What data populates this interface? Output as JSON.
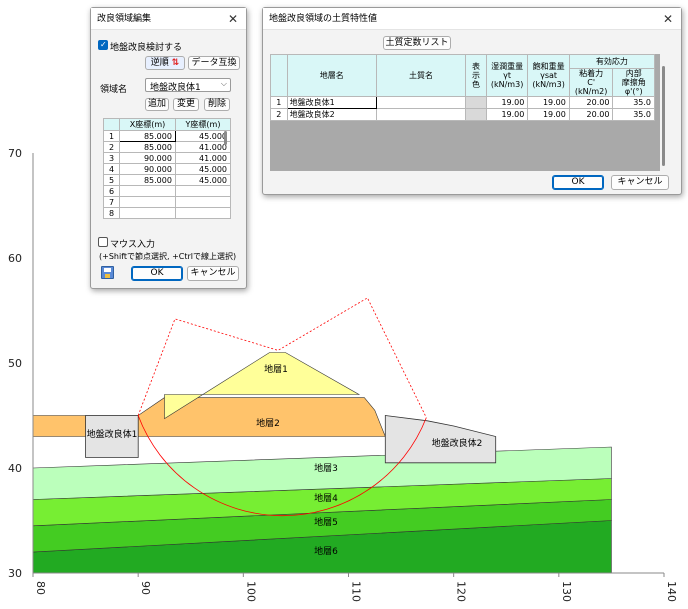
{
  "plot": {
    "y_ticks": [
      "70",
      "60",
      "50",
      "40",
      "30"
    ],
    "x_ticks": [
      "80",
      "90",
      "100",
      "110",
      "120",
      "130",
      "140"
    ],
    "layer_labels": [
      "地層1",
      "地層2",
      "地層3",
      "地層4",
      "地層5",
      "地層6"
    ],
    "improvement_labels": [
      "地盤改良体1",
      "地盤改良体2"
    ],
    "colors": {
      "layer1": "#ffff99",
      "layer2": "#ffc36b",
      "layer3": "#bbffbb",
      "layer4": "#77ee33",
      "layer5": "#44cc22",
      "layer6": "#22aa22",
      "improvement": "#e4e4e4",
      "slip_circle": "#ff0000"
    }
  },
  "chart_data": {
    "type": "area",
    "xlim": [
      80,
      140
    ],
    "ylim": [
      30,
      70
    ],
    "layers": [
      {
        "name": "地層1",
        "polygon": [
          [
            92.5,
            44.7
          ],
          [
            102.5,
            51.0
          ],
          [
            104.0,
            51.0
          ],
          [
            111.0,
            47.0
          ],
          [
            92.5,
            47.0
          ]
        ]
      },
      {
        "name": "地層2",
        "polygon": [
          [
            80,
            45
          ],
          [
            90,
            45
          ],
          [
            92.5,
            46.7
          ],
          [
            111.5,
            46.7
          ],
          [
            112.5,
            45.5
          ],
          [
            113.5,
            43
          ],
          [
            80,
            43
          ]
        ]
      },
      {
        "name": "地層3",
        "polygon": [
          [
            80,
            40
          ],
          [
            135,
            42
          ],
          [
            135,
            39
          ],
          [
            80,
            37
          ]
        ]
      },
      {
        "name": "地層4",
        "polygon": [
          [
            80,
            37
          ],
          [
            135,
            39
          ],
          [
            135,
            37
          ],
          [
            80,
            34.5
          ]
        ]
      },
      {
        "name": "地層5",
        "polygon": [
          [
            80,
            34.5
          ],
          [
            135,
            37
          ],
          [
            135,
            35
          ],
          [
            80,
            32
          ]
        ]
      },
      {
        "name": "地層6",
        "polygon": [
          [
            80,
            32
          ],
          [
            135,
            35
          ],
          [
            135,
            30
          ],
          [
            80,
            30
          ]
        ]
      }
    ],
    "improvement_bodies": [
      {
        "name": "地盤改良体1",
        "points": [
          [
            85,
            45
          ],
          [
            90,
            45
          ],
          [
            90,
            41
          ],
          [
            85,
            41
          ]
        ]
      },
      {
        "name": "地盤改良体2",
        "points": [
          [
            113.5,
            45
          ],
          [
            117.5,
            44.5
          ],
          [
            120.0,
            44.0
          ],
          [
            124.0,
            43.0
          ],
          [
            124.0,
            40.5
          ],
          [
            113.5,
            40.5
          ]
        ]
      }
    ]
  },
  "edit_dialog": {
    "title": "改良領域編集",
    "check_label": "地盤改良検討する",
    "check_on": true,
    "reverse_label": "逆順",
    "data_swap_label": "データ互換",
    "region_label": "領域名",
    "region_value": "地盤改良体1",
    "add_label": "追加",
    "change_label": "変更",
    "delete_label": "削除",
    "col_x": "X座標(m)",
    "col_y": "Y座標(m)",
    "rows": [
      {
        "i": "1",
        "x": "85.000",
        "y": "45.000"
      },
      {
        "i": "2",
        "x": "85.000",
        "y": "41.000"
      },
      {
        "i": "3",
        "x": "90.000",
        "y": "41.000"
      },
      {
        "i": "4",
        "x": "90.000",
        "y": "45.000"
      },
      {
        "i": "5",
        "x": "85.000",
        "y": "45.000"
      },
      {
        "i": "6",
        "x": "",
        "y": ""
      },
      {
        "i": "7",
        "x": "",
        "y": ""
      },
      {
        "i": "8",
        "x": "",
        "y": ""
      }
    ],
    "mouse_label": "マウス入力",
    "mouse_on": false,
    "hint": "(+Shiftで節点選択, +Ctrlで線上選択)",
    "ok_label": "OK",
    "cancel_label": "キャンセル"
  },
  "prop_dialog": {
    "title": "地盤改良領域の土質特性値",
    "fixed_list_label": "土質定数リスト",
    "h_layer": "地層名",
    "h_soil": "土質名",
    "h_color": "表示色",
    "h_wet": "湿潤重量",
    "h_wet2": "γt",
    "h_wet3": "(kN/m3)",
    "h_sat": "飽和重量",
    "h_sat2": "γsat",
    "h_sat3": "(kN/m3)",
    "h_eff": "有効応力",
    "h_c": "粘着力",
    "h_c2": "C'",
    "h_c3": "(kN/m2)",
    "h_phi": "内部",
    "h_phi2": "摩擦角",
    "h_phi3": "φ'(°)",
    "rows": [
      {
        "i": "1",
        "name": "地盤改良体1",
        "soil": "",
        "wet": "19.00",
        "sat": "19.00",
        "c": "20.00",
        "phi": "35.0"
      },
      {
        "i": "2",
        "name": "地盤改良体2",
        "soil": "",
        "wet": "19.00",
        "sat": "19.00",
        "c": "20.00",
        "phi": "35.0"
      }
    ],
    "ok_label": "OK",
    "cancel_label": "キャンセル"
  }
}
